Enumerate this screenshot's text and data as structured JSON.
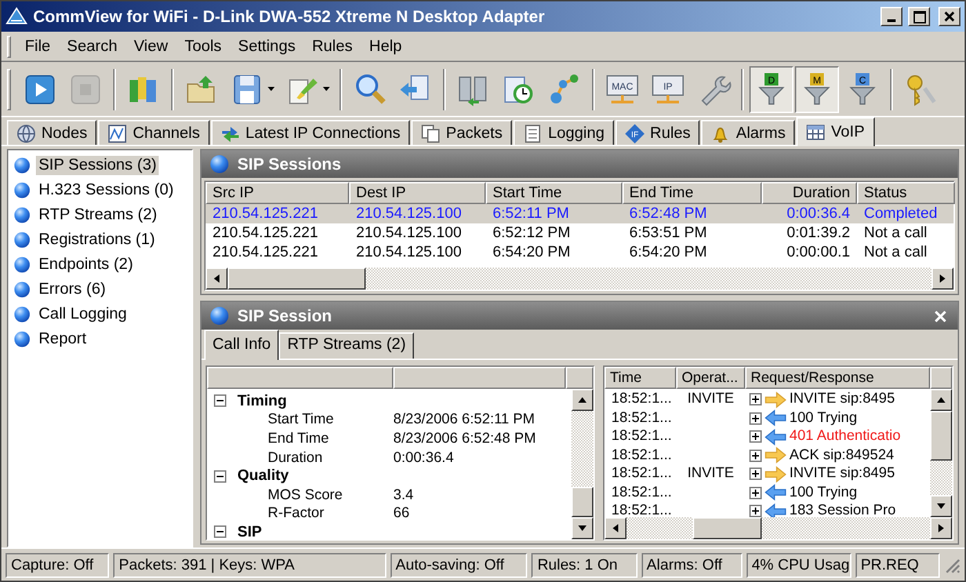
{
  "window": {
    "title": "CommView for WiFi - D-Link DWA-552 Xtreme N Desktop Adapter"
  },
  "menu": [
    "File",
    "Search",
    "View",
    "Tools",
    "Settings",
    "Rules",
    "Help"
  ],
  "toolbar": {
    "groups": [
      [
        {
          "kind": "play",
          "pressed": false,
          "disabled": false,
          "dropdown": false
        },
        {
          "kind": "stop",
          "pressed": false,
          "disabled": true,
          "dropdown": false
        }
      ],
      [
        {
          "kind": "book",
          "pressed": false,
          "disabled": false,
          "dropdown": false
        }
      ],
      [
        {
          "kind": "folder",
          "pressed": false,
          "disabled": false,
          "dropdown": false
        },
        {
          "kind": "disk",
          "pressed": false,
          "disabled": false,
          "dropdown": true
        },
        {
          "kind": "brush",
          "pressed": false,
          "disabled": false,
          "dropdown": true
        }
      ],
      [
        {
          "kind": "search",
          "pressed": false,
          "disabled": false,
          "dropdown": false
        },
        {
          "kind": "document",
          "pressed": false,
          "disabled": false,
          "dropdown": false
        }
      ],
      [
        {
          "kind": "computers",
          "pressed": false,
          "disabled": false,
          "dropdown": false
        },
        {
          "kind": "clock",
          "pressed": false,
          "disabled": false,
          "dropdown": false
        },
        {
          "kind": "network",
          "pressed": false,
          "disabled": false,
          "dropdown": false
        }
      ],
      [
        {
          "kind": "card",
          "label": "MAC",
          "pressed": false,
          "disabled": false,
          "dropdown": false
        },
        {
          "kind": "card",
          "label": "IP",
          "pressed": false,
          "disabled": false,
          "dropdown": false
        },
        {
          "kind": "wrench",
          "pressed": false,
          "disabled": false,
          "dropdown": false
        }
      ],
      [
        {
          "kind": "filter",
          "label": "D",
          "color": "#2e9a2e",
          "pressed": true,
          "disabled": false,
          "dropdown": false
        },
        {
          "kind": "filter",
          "label": "M",
          "color": "#d8b020",
          "pressed": true,
          "disabled": false,
          "dropdown": false
        },
        {
          "kind": "filter",
          "label": "C",
          "color": "#4a8ad8",
          "pressed": false,
          "disabled": false,
          "dropdown": false
        }
      ],
      [
        {
          "kind": "keys",
          "pressed": false,
          "disabled": false,
          "dropdown": false
        }
      ]
    ]
  },
  "tabs": [
    {
      "label": "Nodes",
      "kind": "globe",
      "selected": false
    },
    {
      "label": "Channels",
      "kind": "chart",
      "selected": false
    },
    {
      "label": "Latest IP Connections",
      "kind": "arrows",
      "selected": false
    },
    {
      "label": "Packets",
      "kind": "pages",
      "selected": false
    },
    {
      "label": "Logging",
      "kind": "scroll",
      "selected": false
    },
    {
      "label": "Rules",
      "kind": "diamond",
      "icon_label": "IF",
      "selected": false
    },
    {
      "label": "Alarms",
      "kind": "bell",
      "selected": false
    },
    {
      "label": "VoIP",
      "kind": "table",
      "selected": true
    }
  ],
  "sidebar": {
    "items": [
      {
        "label": "SIP Sessions (3)",
        "selected": true
      },
      {
        "label": "H.323 Sessions (0)",
        "selected": false
      },
      {
        "label": "RTP Streams (2)",
        "selected": false
      },
      {
        "label": "Registrations (1)",
        "selected": false
      },
      {
        "label": "Endpoints (2)",
        "selected": false
      },
      {
        "label": "Errors (6)",
        "selected": false
      },
      {
        "label": "Call Logging",
        "selected": false
      },
      {
        "label": "Report",
        "selected": false
      }
    ]
  },
  "sip_sessions": {
    "title": "SIP Sessions",
    "columns": [
      "Src IP",
      "Dest IP",
      "Start Time",
      "End Time",
      "Duration",
      "Status"
    ],
    "rows": [
      {
        "cells": [
          "210.54.125.221",
          "210.54.125.100",
          "6:52:11 PM",
          "6:52:48 PM",
          "0:00:36.4",
          "Completed"
        ],
        "selected": true,
        "completed": true
      },
      {
        "cells": [
          "210.54.125.221",
          "210.54.125.100",
          "6:52:12 PM",
          "6:53:51 PM",
          "0:01:39.2",
          "Not a call"
        ],
        "selected": false,
        "completed": false
      },
      {
        "cells": [
          "210.54.125.221",
          "210.54.125.100",
          "6:54:20 PM",
          "6:54:20 PM",
          "0:00:00.1",
          "Not a call"
        ],
        "selected": false,
        "completed": false
      }
    ]
  },
  "sip_session": {
    "title": "SIP Session",
    "tabs": [
      {
        "label": "Call Info",
        "selected": true
      },
      {
        "label": "RTP Streams (2)",
        "selected": false
      }
    ],
    "call_info": {
      "groups": [
        {
          "label": "Timing",
          "expanded": true,
          "fields": [
            {
              "name": "Start Time",
              "value": "8/23/2006 6:52:11 PM"
            },
            {
              "name": "End Time",
              "value": "8/23/2006 6:52:48 PM"
            },
            {
              "name": "Duration",
              "value": "0:00:36.4"
            }
          ]
        },
        {
          "label": "Quality",
          "expanded": true,
          "fields": [
            {
              "name": "MOS Score",
              "value": "3.4"
            },
            {
              "name": "R-Factor",
              "value": "66"
            }
          ]
        },
        {
          "label": "SIP",
          "expanded": true
        }
      ]
    },
    "messages": {
      "columns": [
        "Time",
        "Operat...",
        "Request/Response"
      ],
      "rows": [
        {
          "time": "18:52:1...",
          "operation": "INVITE",
          "request": "INVITE sip:8495",
          "kind": "request",
          "error": false,
          "expanded": false
        },
        {
          "time": "18:52:1...",
          "request": "100 Trying",
          "kind": "response",
          "error": false,
          "expanded": false
        },
        {
          "time": "18:52:1...",
          "request": "401 Authenticatio",
          "kind": "response",
          "error": true,
          "expanded": false
        },
        {
          "time": "18:52:1...",
          "request": "ACK sip:849524",
          "kind": "request",
          "error": false,
          "expanded": false
        },
        {
          "time": "18:52:1...",
          "operation": "INVITE",
          "request": "INVITE sip:8495",
          "kind": "request",
          "error": false,
          "expanded": false
        },
        {
          "time": "18:52:1...",
          "request": "100 Trying",
          "kind": "response",
          "error": false,
          "expanded": false
        },
        {
          "time": "18:52:1...",
          "request": "183 Session Pro",
          "kind": "response",
          "error": false,
          "expanded": false
        }
      ]
    }
  },
  "status_bar": [
    "Capture: Off",
    "Packets: 391 | Keys: WPA",
    "Auto-saving: Off",
    "Rules: 1 On",
    "Alarms: Off",
    "4% CPU Usag",
    "PR.REQ"
  ]
}
